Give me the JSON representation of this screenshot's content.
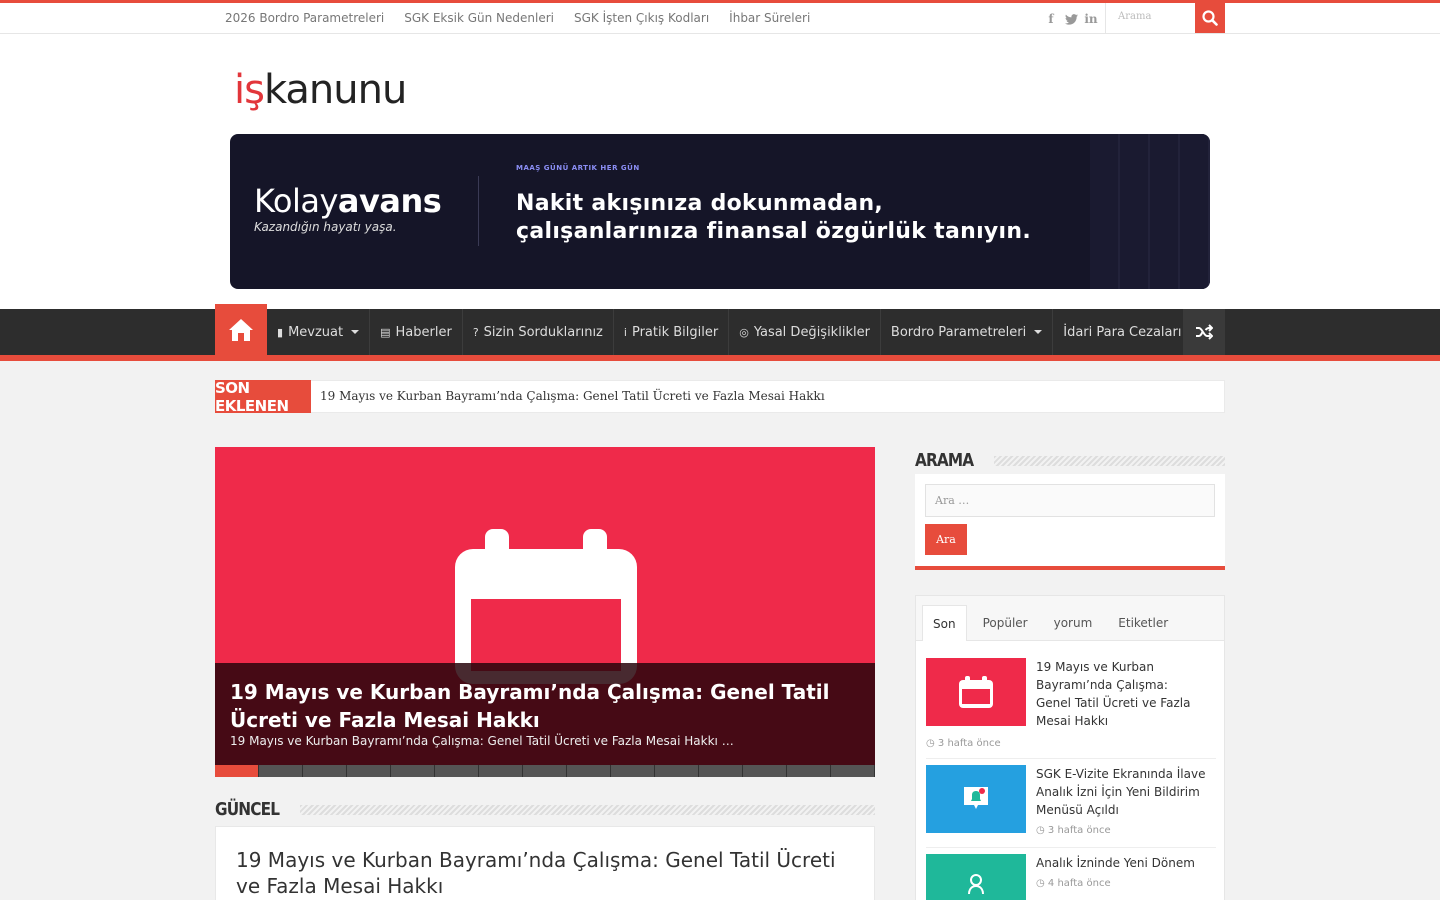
{
  "topbar": {
    "links": [
      "2026 Bordro Parametreleri",
      "SGK Eksik Gün Nedenleri",
      "SGK İşten Çıkış Kodları",
      "İhbar Süreleri"
    ],
    "social": [
      "f",
      "t",
      "in"
    ],
    "search_placeholder": "Arama"
  },
  "header": {
    "logo_red": "iş",
    "logo_dark": "kanunu",
    "banner": {
      "brand_light": "Kolay",
      "brand_bold": "avans",
      "slogan": "Kazandığın hayatı yaşa.",
      "kicker": "MAAŞ GÜNÜ ARTIK HER GÜN",
      "headline_1": "Nakit akışınıza dokunmadan,",
      "headline_2": "çalışanlarınıza finansal özgürlük tanıyın."
    }
  },
  "nav": {
    "items": [
      {
        "label": "Mevzuat",
        "icon": "book-icon",
        "glyph": "▮",
        "dropdown": true
      },
      {
        "label": "Haberler",
        "icon": "newspaper-icon",
        "glyph": "▤",
        "dropdown": false
      },
      {
        "label": "Sizin Sorduklarınız",
        "icon": "question-icon",
        "glyph": "?",
        "dropdown": false
      },
      {
        "label": "Pratik Bilgiler",
        "icon": "info-icon",
        "glyph": "i",
        "dropdown": false
      },
      {
        "label": "Yasal Değişiklikler",
        "icon": "compass-icon",
        "glyph": "◎",
        "dropdown": false
      },
      {
        "label": "Bordro Parametreleri",
        "icon": "",
        "glyph": "",
        "dropdown": true
      },
      {
        "label": "İdari Para Cezaları",
        "icon": "",
        "glyph": "",
        "dropdown": true
      }
    ]
  },
  "breaking": {
    "label": "SON EKLENEN",
    "text": "19 Mayıs ve Kurban Bayramı’nda Çalışma: Genel Tatil Ücreti ve Fazla Mesai Hakkı"
  },
  "slider": {
    "title": "19 Mayıs ve Kurban Bayramı’nda Çalışma: Genel Tatil Ücreti ve Fazla Mesai Hakkı",
    "excerpt": "19 Mayıs ve Kurban Bayramı’nda Çalışma: Genel Tatil Ücreti ve Fazla Mesai Hakkı …",
    "active_slide": 1,
    "slide_count": 15
  },
  "guncel": {
    "heading": "GÜNCEL",
    "post_title": "19 Mayıs ve Kurban Bayramı’nda Çalışma: Genel Tatil Ücreti ve Fazla Mesai Hakkı"
  },
  "sidebar": {
    "search_heading": "ARAMA",
    "search_placeholder": "Ara …",
    "search_button": "Ara",
    "tabs": [
      "Son",
      "Popüler",
      "yorum",
      "Etiketler"
    ],
    "posts": [
      {
        "title": "19 Mayıs ve Kurban Bayramı’nda Çalışma: Genel Tatil Ücreti ve Fazla Mesai Hakkı",
        "meta": "3 hafta önce",
        "thumb_color": "#ef2a4a"
      },
      {
        "title": "SGK E-Vizite Ekranında İlave Analık İzni İçin Yeni Bildirim Menüsü Açıldı",
        "meta": "3 hafta önce",
        "thumb_color": "#25a0e0"
      },
      {
        "title": "Analık İzninde Yeni Dönem",
        "meta": "4 hafta önce",
        "thumb_color": "#1fb89a"
      }
    ]
  },
  "colors": {
    "accent": "#e74c3c",
    "nav_bg": "#2d2d2d",
    "banner_bg": "#151528"
  }
}
